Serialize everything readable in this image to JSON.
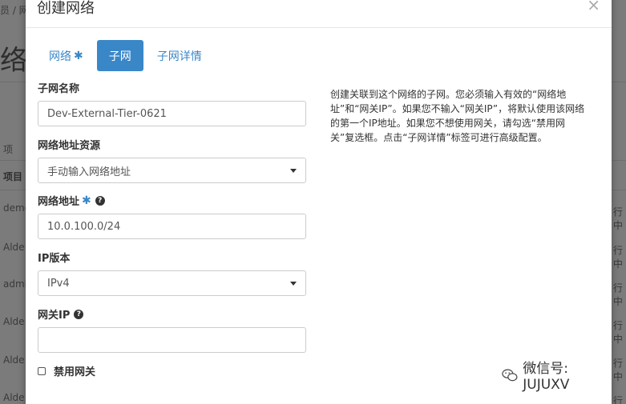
{
  "background": {
    "breadcrumb": "员 / 网",
    "big_title": "络",
    "items_label": "项",
    "header_col": "项目",
    "rows": [
      "demo",
      "Alde",
      "admi",
      "Alde",
      "Alde",
      "Alde"
    ],
    "right_col": [
      "行中",
      "行中",
      "行中",
      "行中",
      "行中",
      "行中"
    ]
  },
  "modal": {
    "title": "创建网络",
    "tabs": [
      {
        "label": "网络",
        "required": true,
        "active": false
      },
      {
        "label": "子网",
        "required": false,
        "active": true
      },
      {
        "label": "子网详情",
        "required": false,
        "active": false
      }
    ],
    "fields": {
      "subnet_name": {
        "label": "子网名称",
        "value": "Dev-External-Tier-0621"
      },
      "address_source": {
        "label": "网络地址资源",
        "value": "手动输入网络地址"
      },
      "network_address": {
        "label": "网络地址",
        "value": "10.0.100.0/24",
        "required": true
      },
      "ip_version": {
        "label": "IP版本",
        "value": "IPv4"
      },
      "gateway_ip": {
        "label": "网关IP",
        "value": ""
      }
    },
    "disable_gateway_label": "禁用网关",
    "help_text": "创建关联到这个网络的子网。您必须输入有效的“网络地址”和“网关IP”。如果您不输入“网关IP”，将默认使用该网络的第一个IP地址。如果您不想使用网关，请勾选“禁用网关”复选框。点击“子网详情”标签可进行高级配置。",
    "required_symbol": "✱",
    "help_symbol": "?"
  },
  "watermark": "微信号: JUJUXV"
}
